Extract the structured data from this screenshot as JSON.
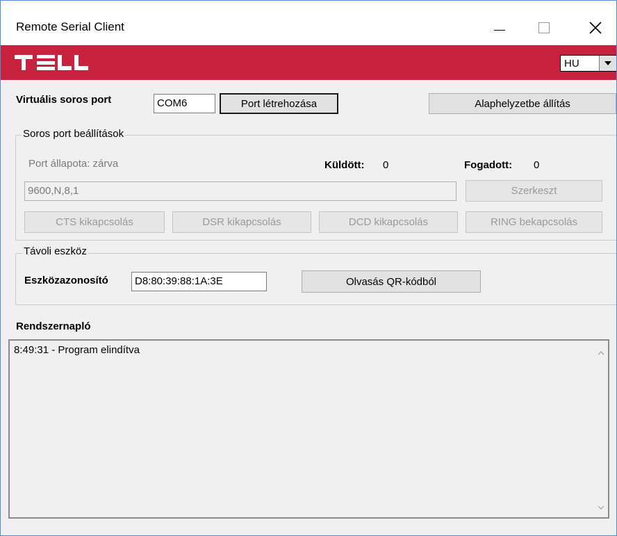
{
  "window": {
    "title": "Remote Serial Client"
  },
  "header": {
    "brand": "TELL",
    "language": "HU"
  },
  "toolbar": {
    "virtual_port_label": "Virtuális soros port",
    "port_value": "COM6",
    "create_port_button": "Port létrehozása",
    "reset_button": "Alaphelyzetbe állítás"
  },
  "serial_settings": {
    "legend": "Soros port beállítások",
    "port_status": "Port állapota: zárva",
    "sent_label": "Küldött:",
    "sent_value": "0",
    "received_label": "Fogadott:",
    "received_value": "0",
    "config_value": "9600,N,8,1",
    "edit_button": "Szerkeszt",
    "cts_button": "CTS kikapcsolás",
    "dsr_button": "DSR kikapcsolás",
    "dcd_button": "DCD kikapcsolás",
    "ring_button": "RING bekapcsolás"
  },
  "remote_device": {
    "legend": "Távoli eszköz",
    "device_id_label": "Eszközazonosító",
    "device_id_value": "D8:80:39:88:1A:3E",
    "qr_button": "Olvasás QR-kódból"
  },
  "system_log": {
    "title": "Rendszernapló",
    "entries": [
      "8:49:31 - Program elindítva"
    ]
  },
  "colors": {
    "brand_red": "#c8223f",
    "window_bg": "#f0f0f0",
    "border_blue": "#4a90d9"
  }
}
